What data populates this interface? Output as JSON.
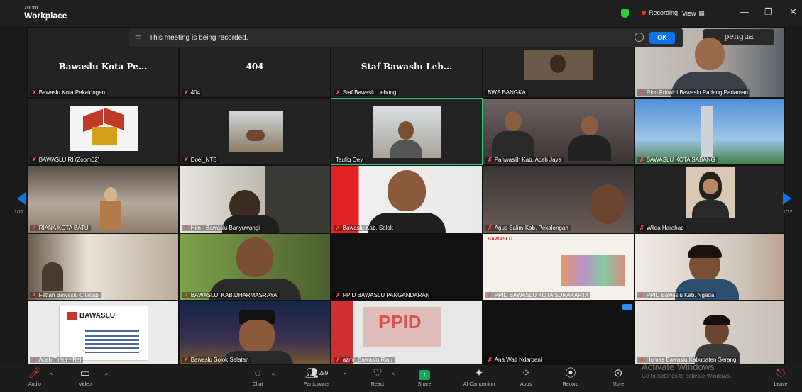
{
  "app": {
    "brand_small": "zoom",
    "brand_big": "Workplace"
  },
  "titlebar": {
    "recording": "Recording",
    "view": "View",
    "view_icon": "grid-icon",
    "min": "—",
    "max": "❐",
    "close": "✕"
  },
  "banner": {
    "text": "This meeting is being recorded.",
    "ok": "OK",
    "info": "i"
  },
  "pager": {
    "left": "1/12",
    "right": "1/12"
  },
  "tiles": {
    "r0c0": {
      "big": "Bawaslu Kota Pe...",
      "name": "Bawaslu Kota Pekalongan"
    },
    "r0c1": {
      "big": "404",
      "name": "404"
    },
    "r0c2": {
      "big": "Staf Bawaslu Leb...",
      "name": "Staf Bawaslu Lebong"
    },
    "r0c3": {
      "name": "BWS BANGKA"
    },
    "r0c4": {
      "name": "Rico Frinaldi Bawaslu Padang Pariaman",
      "sign": "pengua"
    },
    "r1c0": {
      "name": "BAWASLU RI (Zoom02)"
    },
    "r1c1": {
      "name": "Doel_NTB"
    },
    "r1c2": {
      "name": "Taufiq Oey"
    },
    "r1c3": {
      "name": "Panwaslih Kab. Aceh Jaya"
    },
    "r1c4": {
      "name": "BAWASLU KOTA SABANG"
    },
    "r2c0": {
      "name": "RIANA KOTA BATU"
    },
    "r2c1": {
      "name": "Him - Bawaslu Banyuwangi"
    },
    "r2c2": {
      "name": "Bawaslu Kab. Solok"
    },
    "r2c3": {
      "name": "Agus Salim-Kab. Pekalongan"
    },
    "r2c4": {
      "name": "Wilda Harahap"
    },
    "r3c0": {
      "name": "Fattah Bawaslu Cilacap"
    },
    "r3c1": {
      "name": "BAWASLU_KAB.DHARMASRAYA"
    },
    "r3c2": {
      "name": "PPID BAWASLU PANGANDARAN"
    },
    "r3c3": {
      "name": "PPID BAWASLU KOTA SURAKARTA",
      "logo": "BAWASLU"
    },
    "r3c4": {
      "name": "PPID Bawaslu Kab. Ngada"
    },
    "r4c0": {
      "name": "Aceh Timur - Rai",
      "logo": "BAWASLU"
    },
    "r4c1": {
      "name": "Bawaslu Solok Selatan"
    },
    "r4c2": {
      "name": "azmi_Bawaslu Riau",
      "sign": "PPID"
    },
    "r4c3": {
      "name": "Ana Wati Ndarbeni"
    },
    "r4c4": {
      "name": "Humas Bawaslu Kabupaten Serang"
    }
  },
  "toolbar": {
    "audio": "Audio",
    "video": "Video",
    "chat": "Chat",
    "participants": "Participants",
    "participants_count": "299",
    "react": "React",
    "share": "Share",
    "ai": "AI Companion",
    "apps": "Apps",
    "record": "Record",
    "more": "More",
    "leave": "Leave"
  },
  "watermark": {
    "title": "Activate Windows",
    "sub": "Go to Settings to activate Windows."
  },
  "colors": {
    "accent": "#0e72ed",
    "share_green": "#13a855",
    "mute_red": "#ff4d4d",
    "active_border": "#2ecc71"
  }
}
